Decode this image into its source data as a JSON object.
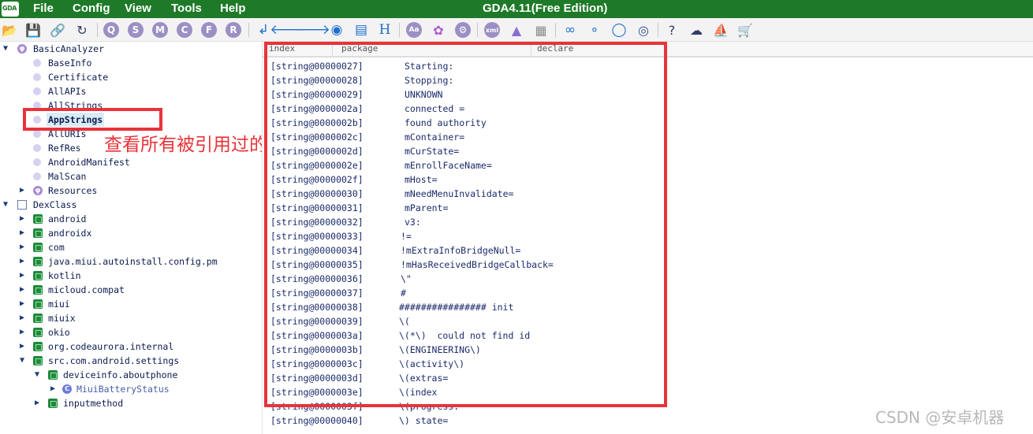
{
  "app": {
    "logo_text": "GDA",
    "title": "GDA4.11(Free Edition)"
  },
  "menu": [
    "File",
    "Config",
    "View",
    "Tools",
    "Help"
  ],
  "toolbar": {
    "circle_letters": [
      "Q",
      "S",
      "M",
      "C",
      "F",
      "R"
    ],
    "h_label": "H",
    "xml_label": "xml",
    "help_label": "?"
  },
  "tree": {
    "basic_analyzer": "BasicAnalyzer",
    "basic_children": [
      "BaseInfo",
      "Certificate",
      "AllAPIs",
      "AllStrings",
      "AppStrings",
      "AllURIs",
      "RefRes",
      "AndroidManifest",
      "MalScan"
    ],
    "resources": "Resources",
    "dexclass": "DexClass",
    "packages": [
      "android",
      "androidx",
      "com",
      "java.miui.autoinstall.config.pm",
      "kotlin",
      "micloud.compat",
      "miui",
      "miuix",
      "okio",
      "org.codeaurora.internal",
      "src.com.android.settings"
    ],
    "sub_package": "deviceinfo.aboutphone",
    "class_item": "MiuiBatteryStatus",
    "sub_package2": "inputmethod",
    "selected": "AppStrings"
  },
  "annotation": {
    "text": "查看所有被引用过的字符串",
    "color": "#e8333a"
  },
  "table": {
    "headers": [
      "index",
      "package",
      "declare"
    ],
    "rows": [
      {
        "key": "[string@00000027]",
        "value": "Starting:"
      },
      {
        "key": "[string@00000028]",
        "value": "Stopping:"
      },
      {
        "key": "[string@00000029]",
        "value": "UNKNOWN"
      },
      {
        "key": "[string@0000002a]",
        "value": "connected ="
      },
      {
        "key": "[string@0000002b]",
        "value": "found authority"
      },
      {
        "key": "[string@0000002c]",
        "value": "mContainer="
      },
      {
        "key": "[string@0000002d]",
        "value": "mCurState="
      },
      {
        "key": "[string@0000002e]",
        "value": "mEnrollFaceName="
      },
      {
        "key": "[string@0000002f]",
        "value": "mHost="
      },
      {
        "key": "[string@00000030]",
        "value": "mNeedMenuInvalidate="
      },
      {
        "key": "[string@00000031]",
        "value": "mParent="
      },
      {
        "key": "[string@00000032]",
        "value": "v3:"
      },
      {
        "key": "[string@00000033]",
        "value": "!="
      },
      {
        "key": "[string@00000034]",
        "value": "!mExtraInfoBridgeNull="
      },
      {
        "key": "[string@00000035]",
        "value": "!mHasReceivedBridgeCallback="
      },
      {
        "key": "[string@00000036]",
        "value": "\\\""
      },
      {
        "key": "[string@00000037]",
        "value": "#"
      },
      {
        "key": "[string@00000038]",
        "value": "################ init"
      },
      {
        "key": "[string@00000039]",
        "value": "\\("
      },
      {
        "key": "[string@0000003a]",
        "value": "\\(*\\)  could not find id"
      },
      {
        "key": "[string@0000003b]",
        "value": "\\(ENGINEERING\\)"
      },
      {
        "key": "[string@0000003c]",
        "value": "\\(activity\\)"
      },
      {
        "key": "[string@0000003d]",
        "value": "\\(extras="
      },
      {
        "key": "[string@0000003e]",
        "value": "\\(index"
      },
      {
        "key": "[string@0000003f]",
        "value": "\\(progress:"
      },
      {
        "key": "[string@00000040]",
        "value": "\\) state="
      }
    ]
  },
  "watermark": "CSDN @安卓机器"
}
